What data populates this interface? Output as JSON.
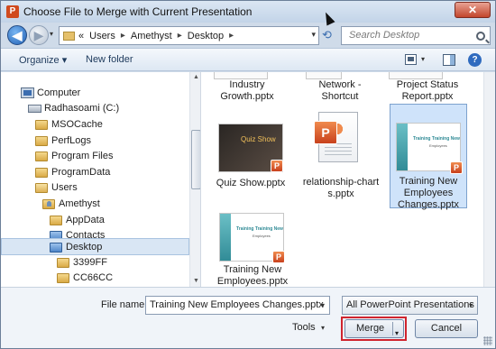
{
  "window": {
    "title": "Choose File to Merge with Current Presentation",
    "app_icon": "P",
    "close_glyph": "✕"
  },
  "nav": {
    "back_glyph": "◀",
    "forward_glyph": "▶",
    "recent_glyph": "▾",
    "refresh_glyph": "⟲"
  },
  "address": {
    "prefix": "«",
    "crumbs": [
      "Users",
      "Amethyst",
      "Desktop"
    ],
    "separator": "▸",
    "dropdown": "▾"
  },
  "search": {
    "placeholder": "Search Desktop"
  },
  "toolbar": {
    "organize": "Organize ▾",
    "new_folder": "New folder",
    "views_caret": "▾",
    "help": "?"
  },
  "tree": {
    "items": [
      {
        "label": "Computer",
        "icon": "computer-icon"
      },
      {
        "label": "Radhasoami (C:)",
        "icon": "drive-icon"
      },
      {
        "label": "MSOCache",
        "icon": "folder-icon"
      },
      {
        "label": "PerfLogs",
        "icon": "folder-icon"
      },
      {
        "label": "Program Files",
        "icon": "folder-icon"
      },
      {
        "label": "ProgramData",
        "icon": "folder-icon"
      },
      {
        "label": "Users",
        "icon": "folder-icon"
      },
      {
        "label": "Amethyst",
        "icon": "user-folder-icon"
      },
      {
        "label": "AppData",
        "icon": "folder-icon"
      },
      {
        "label": "Contacts",
        "icon": "contacts-icon"
      },
      {
        "label": "Desktop",
        "icon": "desktop-folder-icon",
        "selected": true
      },
      {
        "label": "3399FF",
        "icon": "folder-icon"
      },
      {
        "label": "CC66CC",
        "icon": "folder-icon"
      }
    ]
  },
  "files": {
    "top_row": [
      {
        "name": "Industry Growth.pptx",
        "line1": "Industry",
        "line2": "Growth.pptx"
      },
      {
        "name": "Network - Shortcut",
        "line1": "Network -",
        "line2": "Shortcut"
      },
      {
        "name": "Project Status Report.pptx",
        "line1": "Project Status",
        "line2": "Report.pptx"
      }
    ],
    "quiz": {
      "line1": "Quiz Show.pptx",
      "thumb_text": "Quiz Show"
    },
    "relationship": {
      "line1": "relationship-chart",
      "line2": "s.pptx"
    },
    "tne_selected": {
      "line1": "Training New",
      "line2": "Employees",
      "line3": "Changes.pptx",
      "thumb_title": "Training Training New",
      "thumb_sub": "Employees"
    },
    "tne": {
      "line1": "Training New",
      "line2": "Employees.pptx",
      "thumb_title": "Training Training New",
      "thumb_sub": "Employees"
    },
    "badge": "P"
  },
  "footer": {
    "file_name_label": "File name:",
    "file_name_value": "Training New Employees Changes.pptx",
    "filter_value": "All PowerPoint Presentations (*",
    "tools_label": "Tools",
    "merge_label": "Merge",
    "cancel_label": "Cancel",
    "caret": "▾"
  },
  "colors": {
    "accent": "#2f6bbf",
    "highlight": "#d0242e",
    "selection": "#cfe3fa"
  }
}
